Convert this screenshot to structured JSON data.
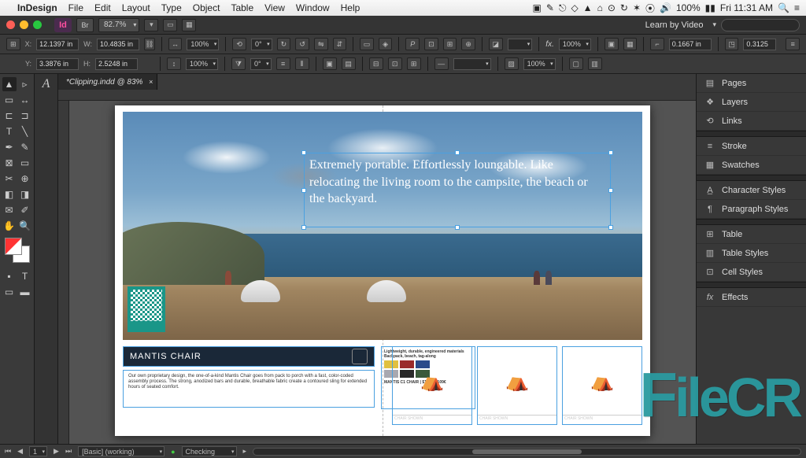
{
  "menubar": {
    "app": "InDesign",
    "items": [
      "File",
      "Edit",
      "Layout",
      "Type",
      "Object",
      "Table",
      "View",
      "Window",
      "Help"
    ],
    "battery": "100%",
    "clock": "Fri 11:31 AM"
  },
  "appstrip": {
    "id_badge": "Id",
    "br_label": "Br",
    "zoom": "82.7%",
    "learn_label": "Learn by Video"
  },
  "controlbar": {
    "x_label": "X:",
    "x_value": "12.1397 in",
    "y_label": "Y:",
    "y_value": "3.3876 in",
    "w_label": "W:",
    "w_value": "10.4835 in",
    "h_label": "H:",
    "h_value": "2.5248 in",
    "scale_x": "100%",
    "scale_y": "100%",
    "rotate": "0°",
    "shear": "0°",
    "stroke_w": "0.1667 in",
    "opacity_a": "100%",
    "opacity_b": "100%",
    "corners": "0.3125"
  },
  "document": {
    "tab_title": "*Clipping.indd @ 83%"
  },
  "hero": {
    "text": "Extremely portable. Effortlessly loungable. Like relocating the living room to the campsite, the beach or the backyard."
  },
  "product": {
    "title": "MANTIS CHAIR",
    "desc": "Our own proprietary design, the one-of-a-kind Mantis Chair goes from pack to porch with a fast, color-coded assembly process. The strong, anodized bars and durable, breathable fabric create a contoured sling for extended hours of seated comfort.",
    "swatch_label_1": "Lightweight, durable, engineered materials",
    "swatch_label_2": "Backpack, beach, tag-along",
    "colors_row1": [
      "#e0c040",
      "#9a2a2a",
      "#2a4a8a"
    ],
    "colors_row2": [
      "#a8a8b0",
      "#2a2a2a",
      "#3a5a3a"
    ],
    "sku_line": "MANTIS C1 CHAIR | $119.95/109€"
  },
  "thumbs": {
    "caption": "CHAIR SHOWN"
  },
  "right_panels": {
    "group1": [
      {
        "icon": "▤",
        "label": "Pages"
      },
      {
        "icon": "❖",
        "label": "Layers"
      },
      {
        "icon": "⟲",
        "label": "Links"
      }
    ],
    "group2": [
      {
        "icon": "≡",
        "label": "Stroke"
      },
      {
        "icon": "▦",
        "label": "Swatches"
      }
    ],
    "group3": [
      {
        "icon": "A̲",
        "label": "Character Styles"
      },
      {
        "icon": "¶",
        "label": "Paragraph Styles"
      }
    ],
    "group4": [
      {
        "icon": "⊞",
        "label": "Table"
      },
      {
        "icon": "▥",
        "label": "Table Styles"
      },
      {
        "icon": "⊡",
        "label": "Cell Styles"
      }
    ],
    "group5": [
      {
        "icon": "fx",
        "label": "Effects"
      }
    ]
  },
  "statusbar": {
    "page_nav": "1",
    "master": "[Basic] (working)",
    "check": "Checking"
  },
  "watermark": "FileCR"
}
